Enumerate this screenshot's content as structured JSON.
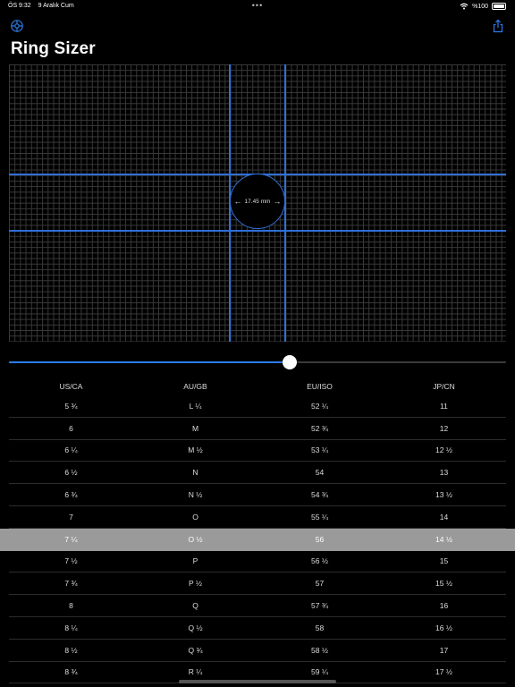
{
  "status_bar": {
    "time": "ÖS 9:32",
    "date": "9 Aralık Cum",
    "dots": "•••",
    "battery": "%100"
  },
  "header": {
    "title": "Ring Sizer",
    "settings_icon": "gear-icon",
    "share_icon": "share-icon"
  },
  "accent_color": "#2f6fd6",
  "ring": {
    "diameter_label": "17.45 mm"
  },
  "slider": {
    "value": 0.565
  },
  "table": {
    "columns": [
      "US/CA",
      "AU/GB",
      "EU/ISO",
      "JP/CN"
    ],
    "selected_index": 6,
    "rows": [
      [
        "5 ¾",
        "L ¼",
        "52 ¼",
        "11"
      ],
      [
        "6",
        "M",
        "52 ¾",
        "12"
      ],
      [
        "6 ¼",
        "M ½",
        "53 ¼",
        "12 ½"
      ],
      [
        "6 ½",
        "N",
        "54",
        "13"
      ],
      [
        "6 ¾",
        "N ½",
        "54 ¾",
        "13 ½"
      ],
      [
        "7",
        "O",
        "55 ¼",
        "14"
      ],
      [
        "7 ¼",
        "O ½",
        "56",
        "14 ½"
      ],
      [
        "7 ½",
        "P",
        "56 ½",
        "15"
      ],
      [
        "7 ¾",
        "P ½",
        "57",
        "15 ½"
      ],
      [
        "8",
        "Q",
        "57 ¾",
        "16"
      ],
      [
        "8 ¼",
        "Q ½",
        "58",
        "16 ½"
      ],
      [
        "8 ½",
        "Q ¾",
        "58 ½",
        "17"
      ],
      [
        "8 ¾",
        "R ¼",
        "59 ¼",
        "17 ½"
      ]
    ]
  }
}
